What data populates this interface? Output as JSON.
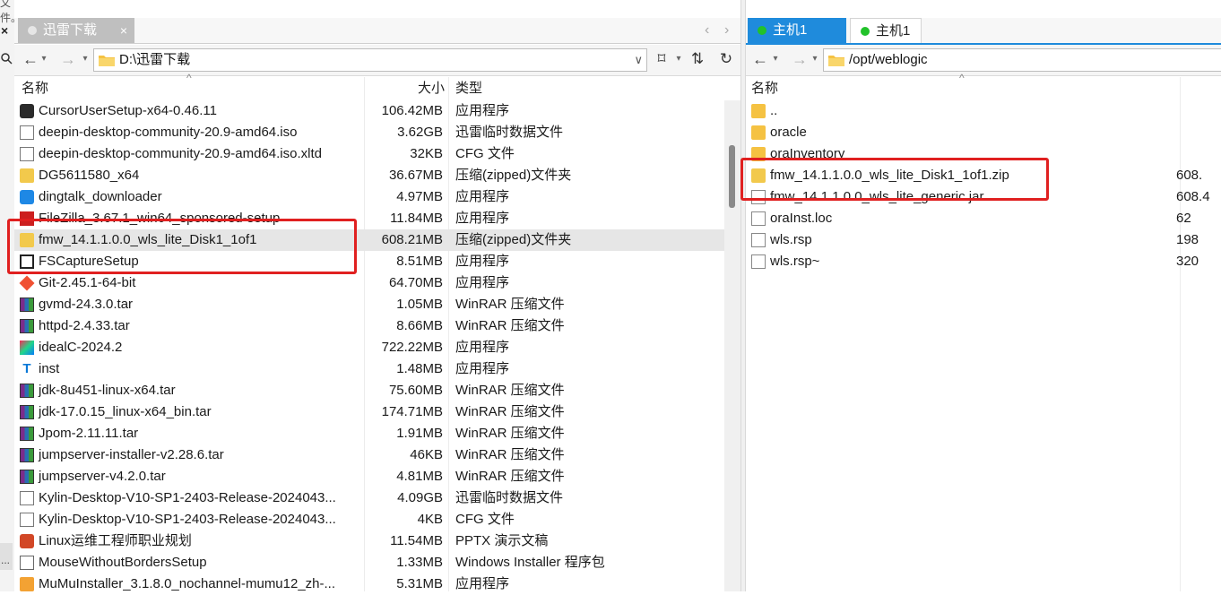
{
  "left_edge": {
    "top_text": "文件。",
    "close_glyph": "×",
    "dots": "..."
  },
  "left_panel": {
    "tab": {
      "label": "迅雷下载",
      "close": "×"
    },
    "tab_nav": {
      "prev": "‹",
      "next": "›"
    },
    "address": {
      "back": "←",
      "back_menu": "▾",
      "forward": "→",
      "forward_menu": "▾",
      "path": "D:\\迅雷下载",
      "dropdown": "∨",
      "bookmark": "⌑",
      "bookmark_menu": "▾",
      "sync": "⇅",
      "refresh": "↻"
    },
    "columns": {
      "name": "名称",
      "size": "大小",
      "type": "类型",
      "sort_indicator": "^"
    },
    "files": [
      {
        "name": "CursorUserSetup-x64-0.46.11",
        "size": "106.42MB",
        "type": "应用程序",
        "icon": "exe-icon"
      },
      {
        "name": "deepin-desktop-community-20.9-amd64.iso",
        "size": "3.62GB",
        "type": "迅雷临时数据文件",
        "icon": "iso-icon"
      },
      {
        "name": "deepin-desktop-community-20.9-amd64.iso.xltd",
        "size": "32KB",
        "type": "CFG 文件",
        "icon": "xltd-icon"
      },
      {
        "name": "DG5611580_x64",
        "size": "36.67MB",
        "type": "压缩(zipped)文件夹",
        "icon": "zip-folder-icon"
      },
      {
        "name": "dingtalk_downloader",
        "size": "4.97MB",
        "type": "应用程序",
        "icon": "dingtalk-icon"
      },
      {
        "name": "FileZilla_3.67.1_win64_sponsored-setup",
        "size": "11.84MB",
        "type": "应用程序",
        "icon": "filezilla-icon"
      },
      {
        "name": "fmw_14.1.1.0.0_wls_lite_Disk1_1of1",
        "size": "608.21MB",
        "type": "压缩(zipped)文件夹",
        "icon": "zip-folder-icon"
      },
      {
        "name": "FSCaptureSetup",
        "size": "8.51MB",
        "type": "应用程序",
        "icon": "fscapture-icon"
      },
      {
        "name": "Git-2.45.1-64-bit",
        "size": "64.70MB",
        "type": "应用程序",
        "icon": "git-icon"
      },
      {
        "name": "gvmd-24.3.0.tar",
        "size": "1.05MB",
        "type": "WinRAR 压缩文件",
        "icon": "winrar-icon"
      },
      {
        "name": "httpd-2.4.33.tar",
        "size": "8.66MB",
        "type": "WinRAR 压缩文件",
        "icon": "winrar-icon"
      },
      {
        "name": "idealC-2024.2",
        "size": "722.22MB",
        "type": "应用程序",
        "icon": "idea-icon"
      },
      {
        "name": "inst",
        "size": "1.48MB",
        "type": "应用程序",
        "icon": "inst-icon"
      },
      {
        "name": "jdk-8u451-linux-x64.tar",
        "size": "75.60MB",
        "type": "WinRAR 压缩文件",
        "icon": "winrar-icon"
      },
      {
        "name": "jdk-17.0.15_linux-x64_bin.tar",
        "size": "174.71MB",
        "type": "WinRAR 压缩文件",
        "icon": "winrar-icon"
      },
      {
        "name": "Jpom-2.11.11.tar",
        "size": "1.91MB",
        "type": "WinRAR 压缩文件",
        "icon": "winrar-icon"
      },
      {
        "name": "jumpserver-installer-v2.28.6.tar",
        "size": "46KB",
        "type": "WinRAR 压缩文件",
        "icon": "winrar-icon"
      },
      {
        "name": "jumpserver-v4.2.0.tar",
        "size": "4.81MB",
        "type": "WinRAR 压缩文件",
        "icon": "winrar-icon"
      },
      {
        "name": "Kylin-Desktop-V10-SP1-2403-Release-2024043...",
        "size": "4.09GB",
        "type": "迅雷临时数据文件",
        "icon": "iso-icon"
      },
      {
        "name": "Kylin-Desktop-V10-SP1-2403-Release-2024043...",
        "size": "4KB",
        "type": "CFG 文件",
        "icon": "xltd-icon"
      },
      {
        "name": "Linux运维工程师职业规划",
        "size": "11.54MB",
        "type": "PPTX 演示文稿",
        "icon": "pptx-icon"
      },
      {
        "name": "MouseWithoutBordersSetup",
        "size": "1.33MB",
        "type": "Windows Installer 程序包",
        "icon": "msi-icon"
      },
      {
        "name": "MuMuInstaller_3.1.8.0_nochannel-mumu12_zh-...",
        "size": "5.31MB",
        "type": "应用程序",
        "icon": "package-icon"
      }
    ]
  },
  "right_panel": {
    "tabs": [
      {
        "label": "主机1"
      },
      {
        "label": "主机1"
      }
    ],
    "address": {
      "back": "←",
      "back_menu": "▾",
      "forward": "→",
      "forward_menu": "▾",
      "path": "/opt/weblogic"
    },
    "columns": {
      "name": "名称",
      "sort_indicator": "^"
    },
    "files": [
      {
        "name": "..",
        "size": "",
        "icon": "folder-icon"
      },
      {
        "name": "oracle",
        "size": "",
        "icon": "folder-icon"
      },
      {
        "name": "oraInventory",
        "size": "",
        "icon": "folder-icon"
      },
      {
        "name": "fmw_14.1.1.0.0_wls_lite_Disk1_1of1.zip",
        "size": "608.",
        "icon": "zip-folder-icon"
      },
      {
        "name": "fmw_14.1.1.0.0_wls_lite_generic.jar",
        "size": "608.4",
        "icon": "jar-icon"
      },
      {
        "name": "oraInst.loc",
        "size": "62",
        "icon": "file-icon"
      },
      {
        "name": "wls.rsp",
        "size": "198",
        "icon": "file-icon"
      },
      {
        "name": "wls.rsp~",
        "size": "320",
        "icon": "file-icon"
      }
    ]
  },
  "colors": {
    "accent": "#1f8bdc",
    "highlight_box": "#e02020",
    "selected_row": "#e6e6e6",
    "online_dot": "#22c22a"
  }
}
